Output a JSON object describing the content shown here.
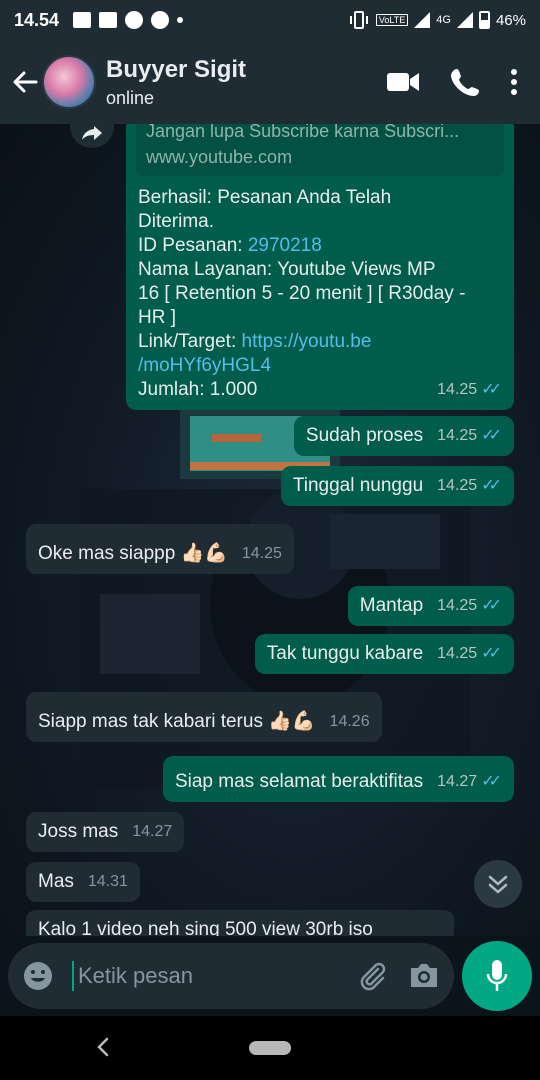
{
  "status_bar": {
    "time": "14.54",
    "battery": "46%",
    "network": "4G",
    "volte": "VoLTE",
    "icon_names": [
      "gallery-icon",
      "news-icon",
      "facebook-icon",
      "whatsapp-icon",
      "dot-icon",
      "vibrate-icon",
      "volte-icon",
      "signal-icon",
      "battery-icon"
    ]
  },
  "header": {
    "contact_name": "Buyyer Sigit",
    "contact_status": "online",
    "icons": [
      "back-arrow-icon",
      "video-call-icon",
      "voice-call-icon",
      "more-vert-icon"
    ]
  },
  "messages": [
    {
      "direction": "out",
      "link_preview_title": "Jangan lupa Subscribe karna Subscri...",
      "link_preview_domain": "www.youtube.com",
      "line1": "Berhasil: Pesanan Anda Telah",
      "line2": "Diterima.",
      "order_label": "ID Pesanan: ",
      "order_id": "2970218",
      "service_line1": "Nama Layanan: Youtube Views MP",
      "service_line2": "16 [ Retention 5 - 20 menit ] [ R30day -",
      "service_line3": "HR ]",
      "link_label": "Link/Target: ",
      "link_part1": "https://youtu.be",
      "link_part2": "/moHYf6yHGL4",
      "amount": "Jumlah: 1.000",
      "time": "14.25",
      "read": true
    },
    {
      "direction": "out",
      "text": "Sudah proses",
      "time": "14.25",
      "read": true
    },
    {
      "direction": "out",
      "text": "Tinggal nunggu",
      "time": "14.25",
      "read": true
    },
    {
      "direction": "in",
      "text": "Oke mas siappp 👍🏻💪🏻",
      "time": "14.25"
    },
    {
      "direction": "out",
      "text": "Mantap",
      "time": "14.25",
      "read": true
    },
    {
      "direction": "out",
      "text": "Tak tunggu kabare",
      "time": "14.25",
      "read": true
    },
    {
      "direction": "in",
      "text": "Siapp mas tak kabari terus 👍🏻💪🏻",
      "time": "14.26"
    },
    {
      "direction": "out",
      "text": "Siap mas selamat beraktifitas",
      "time": "14.27",
      "read": true
    },
    {
      "direction": "in",
      "text": "Joss mas",
      "time": "14.27"
    },
    {
      "direction": "in",
      "text": "Mas",
      "time": "14.31"
    },
    {
      "direction": "in",
      "text": "Kalo 1 video neh sing 500 view 30rb iso",
      "time": ""
    }
  ],
  "input": {
    "placeholder": "Ketik pesan",
    "icons": [
      "emoji-icon",
      "attach-icon",
      "camera-icon",
      "mic-icon"
    ]
  },
  "colors": {
    "outgoing_bubble": "#005c4b",
    "incoming_bubble": "#1f2c34",
    "link": "#53bdeb",
    "accent": "#00a884",
    "header": "#1f2c34"
  }
}
